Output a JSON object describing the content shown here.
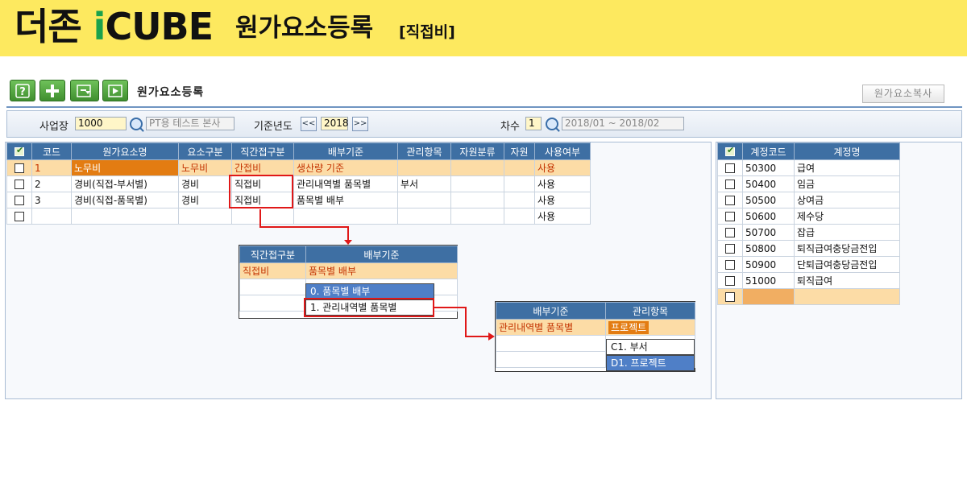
{
  "banner": {
    "brand_prefix": "더존 ",
    "brand_i": "i",
    "brand_suffix": "CUBE",
    "title": "원가요소등록",
    "tag": "[직접비]"
  },
  "window": {
    "screen_title": "원가요소등록",
    "copy_button": "원가요소복사",
    "toolbar_icons": [
      "help-icon",
      "add-icon",
      "refresh-icon",
      "play-icon"
    ]
  },
  "filter": {
    "site_label": "사업장",
    "site_code": "1000",
    "site_name": "PT용 테스트 본사",
    "year_label": "기준년도",
    "prev": "<<",
    "year": "2018",
    "next": ">>",
    "round_label": "차수",
    "round": "1",
    "period": "2018/01 ~ 2018/02"
  },
  "main_grid": {
    "headers": [
      "코드",
      "원가요소명",
      "요소구분",
      "직간접구분",
      "배부기준",
      "관리항목",
      "자원분류",
      "자원",
      "사용여부"
    ],
    "rows": [
      {
        "code": "1",
        "name": "노무비",
        "type": "노무비",
        "direct": "간접비",
        "basis": "생산량 기준",
        "mgmt": "",
        "res_cls": "",
        "res": "",
        "use": "사용"
      },
      {
        "code": "2",
        "name": "경비(직접-부서별)",
        "type": "경비",
        "direct": "직접비",
        "basis": "관리내역별 품목별",
        "mgmt": "부서",
        "res_cls": "",
        "res": "",
        "use": "사용"
      },
      {
        "code": "3",
        "name": "경비(직접-품목별)",
        "type": "경비",
        "direct": "직접비",
        "basis": "품목별 배부",
        "mgmt": "",
        "res_cls": "",
        "res": "",
        "use": "사용"
      },
      {
        "code": "",
        "name": "",
        "type": "",
        "direct": "",
        "basis": "",
        "mgmt": "",
        "res_cls": "",
        "res": "",
        "use": "사용"
      }
    ]
  },
  "popup1": {
    "headers": [
      "직간접구분",
      "배부기준"
    ],
    "direct": "직접비",
    "basis": "품목별 배부",
    "options": [
      "0. 품목별 배부",
      "1. 관리내역별 품목별"
    ]
  },
  "popup2": {
    "headers": [
      "배부기준",
      "관리항목"
    ],
    "basis": "관리내역별 품목별",
    "mgmt": "프로젝트",
    "options": [
      "C1. 부서",
      "D1. 프로젝트"
    ]
  },
  "account_grid": {
    "headers": [
      "계정코드",
      "계정명"
    ],
    "rows": [
      {
        "code": "50300",
        "name": "급여"
      },
      {
        "code": "50400",
        "name": "임금"
      },
      {
        "code": "50500",
        "name": "상여금"
      },
      {
        "code": "50600",
        "name": "제수당"
      },
      {
        "code": "50700",
        "name": "잡급"
      },
      {
        "code": "50800",
        "name": "퇴직급여충당금전입"
      },
      {
        "code": "50900",
        "name": "단퇴급여충당금전입"
      },
      {
        "code": "51000",
        "name": "퇴직급여"
      }
    ]
  },
  "colors": {
    "banner": "#fde95f",
    "header": "#3e6fa3",
    "selected_row": "#fcdca6",
    "selected_text": "#c33200",
    "highlight_orange": "#e37c12",
    "option_blue": "#4f7fc7",
    "red_marker": "#e01818"
  }
}
